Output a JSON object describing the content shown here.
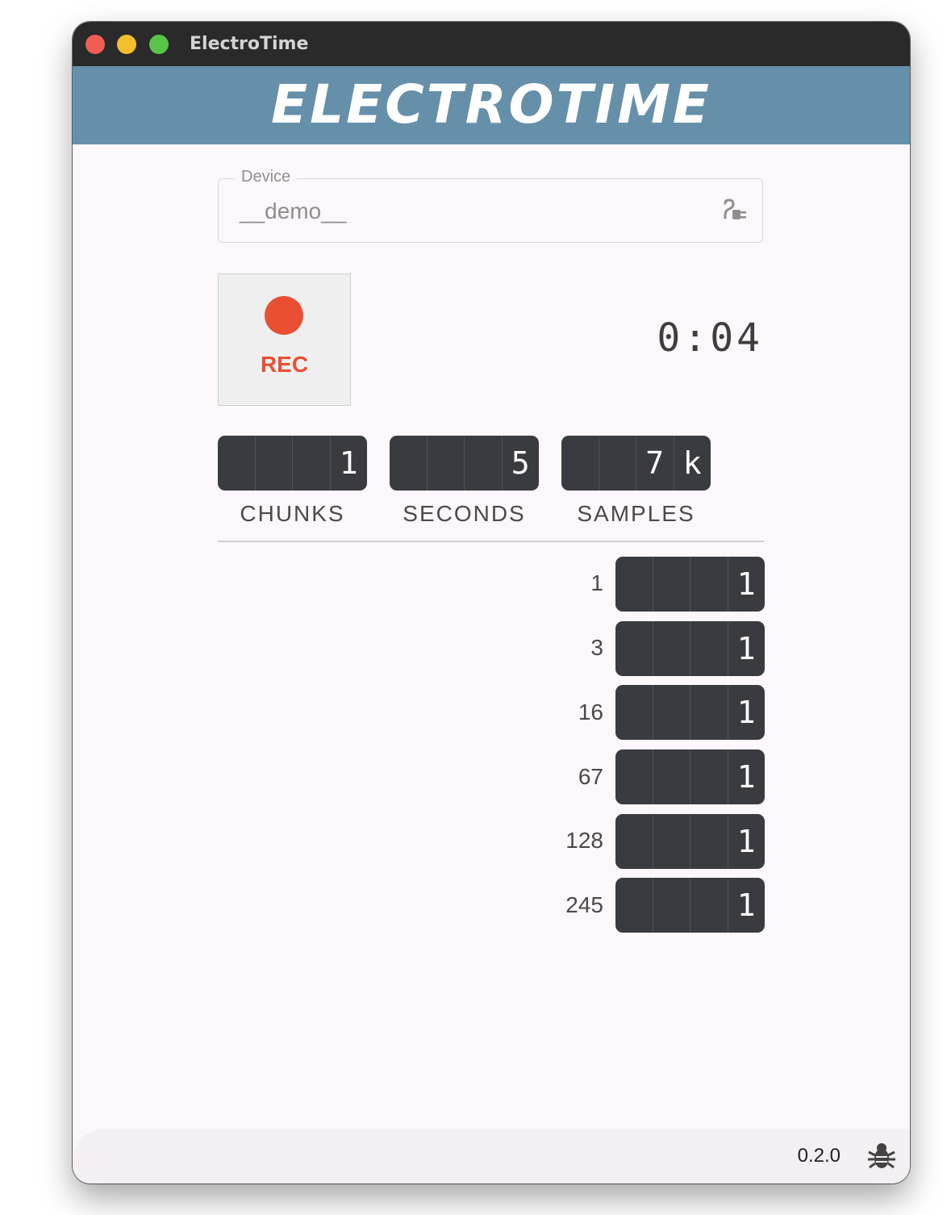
{
  "window": {
    "title": "ElectroTime"
  },
  "banner": {
    "logo_text": "ELECTROTIME"
  },
  "device": {
    "label": "Device",
    "value": "__demo__",
    "icon": "plug-icon"
  },
  "record": {
    "label": "REC",
    "icon": "record-dot-icon"
  },
  "timer": {
    "value": "0:04"
  },
  "stats": [
    {
      "label": "CHUNKS",
      "digits": [
        "",
        "",
        "",
        "1"
      ]
    },
    {
      "label": "SECONDS",
      "digits": [
        "",
        "",
        "",
        "5"
      ]
    },
    {
      "label": "SAMPLES",
      "digits": [
        "",
        "",
        "7",
        "k"
      ]
    }
  ],
  "channels": [
    {
      "id": "1",
      "digits": [
        "",
        "",
        "",
        "1"
      ]
    },
    {
      "id": "3",
      "digits": [
        "",
        "",
        "",
        "1"
      ]
    },
    {
      "id": "16",
      "digits": [
        "",
        "",
        "",
        "1"
      ]
    },
    {
      "id": "67",
      "digits": [
        "",
        "",
        "",
        "1"
      ]
    },
    {
      "id": "128",
      "digits": [
        "",
        "",
        "",
        "1"
      ]
    },
    {
      "id": "245",
      "digits": [
        "",
        "",
        "",
        "1"
      ]
    }
  ],
  "statusbar": {
    "version": "0.2.0",
    "icon": "bug-icon"
  },
  "colors": {
    "banner": "#6690aa",
    "record": "#e84f33",
    "counter_bg": "#3a3b41"
  }
}
